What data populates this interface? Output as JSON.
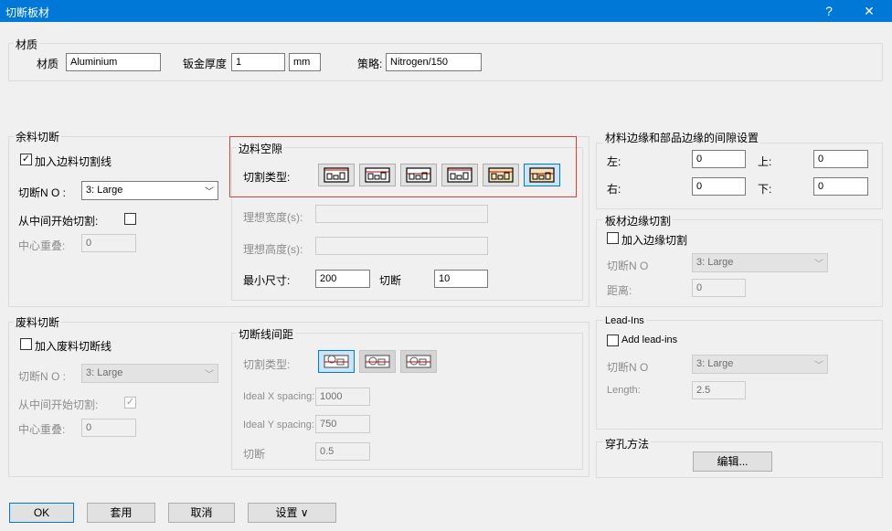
{
  "window": {
    "title": "切断板材",
    "help": "?",
    "close": "✕"
  },
  "material": {
    "group_title": "材质",
    "material_label": "材质",
    "material_value": "Aluminium",
    "thickness_label": "钣金厚度",
    "thickness_value": "1",
    "unit": "mm",
    "strategy_label": "策略:",
    "strategy_value": "Nitrogen/150"
  },
  "remnant": {
    "group_title": "余料切断",
    "add_line_label": "加入边料切割线",
    "add_line_checked": true,
    "cut_no_label": "切断N O :",
    "cut_no_value": "3: Large",
    "start_mid_label": "从中间开始切割:",
    "start_mid_checked": false,
    "center_overlap_label": "中心重叠:",
    "center_overlap_value": "0"
  },
  "edge_gap": {
    "group_title": "边料空隙",
    "cut_type_label": "切割类型:",
    "ideal_width_label": "理想宽度(s):",
    "ideal_width_value": "",
    "ideal_height_label": "理想高度(s):",
    "ideal_height_value": "",
    "min_size_label": "最小尺寸:",
    "min_size_value": "200",
    "cut_label": "切断",
    "cut_value": "10",
    "selected_type": 6
  },
  "margins": {
    "group_title": "材料边缘和部品边缘的间隙设置",
    "left_label": "左:",
    "left_value": "0",
    "top_label": "上:",
    "top_value": "0",
    "right_label": "右:",
    "right_value": "0",
    "bottom_label": "下:",
    "bottom_value": "0"
  },
  "sheet_edge": {
    "group_title": "板材边缘切割",
    "add_label": "加入边缘切割",
    "add_checked": false,
    "cut_no_label": "切断N O",
    "cut_no_value": "3: Large",
    "distance_label": "距离:",
    "distance_value": "0"
  },
  "scrap": {
    "group_title": "废料切断",
    "add_line_label": "加入废料切断线",
    "add_line_checked": false,
    "cut_no_label": "切断N O :",
    "cut_no_value": "3: Large",
    "start_mid_label": "从中间开始切割:",
    "start_mid_checked": true,
    "center_overlap_label": "中心重叠:",
    "center_overlap_value": "0"
  },
  "cut_spacing": {
    "group_title": "切断线间距",
    "cut_type_label": "切割类型:",
    "x_label": "Ideal X spacing:",
    "x_value": "1000",
    "y_label": "Ideal Y spacing:",
    "y_value": "750",
    "cut_label": "切断",
    "cut_value": "0.5",
    "selected_type": 1
  },
  "lead_ins": {
    "group_title": "Lead-Ins",
    "add_label": "Add lead-ins",
    "add_checked": false,
    "cut_no_label": "切断N O",
    "cut_no_value": "3: Large",
    "length_label": "Length:",
    "length_value": "2.5"
  },
  "piercing": {
    "group_title": "穿孔方法",
    "edit_label": "编辑..."
  },
  "footer": {
    "ok": "OK",
    "apply": "套用",
    "cancel": "取消",
    "settings": "设置 ∨"
  },
  "colors": {
    "titlebar": "#0078d7",
    "highlight_box": "#e03c3c",
    "selected_button": "#cce4f7"
  }
}
